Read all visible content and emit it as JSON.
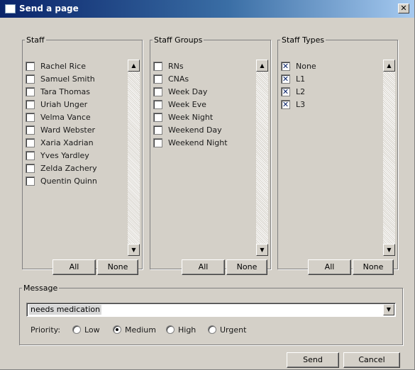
{
  "window": {
    "title": "Send a page",
    "close_glyph": "✕"
  },
  "staff": {
    "legend": "Staff",
    "items": [
      {
        "label": "Rachel Rice",
        "checked": false
      },
      {
        "label": "Samuel Smith",
        "checked": false
      },
      {
        "label": "Tara Thomas",
        "checked": false
      },
      {
        "label": "Uriah Unger",
        "checked": false
      },
      {
        "label": "Velma Vance",
        "checked": false
      },
      {
        "label": "Ward Webster",
        "checked": false
      },
      {
        "label": "Xaria Xadrian",
        "checked": false
      },
      {
        "label": "Yves Yardley",
        "checked": false
      },
      {
        "label": "Zelda Zachery",
        "checked": false
      },
      {
        "label": "Quentin Quinn",
        "checked": false
      }
    ],
    "all_label": "All",
    "none_label": "None"
  },
  "staff_groups": {
    "legend": "Staff Groups",
    "items": [
      {
        "label": "RNs",
        "checked": false
      },
      {
        "label": "CNAs",
        "checked": false
      },
      {
        "label": "Week Day",
        "checked": false
      },
      {
        "label": "Week Eve",
        "checked": false
      },
      {
        "label": "Week Night",
        "checked": false
      },
      {
        "label": "Weekend Day",
        "checked": false
      },
      {
        "label": "Weekend Night",
        "checked": false
      }
    ],
    "all_label": "All",
    "none_label": "None"
  },
  "staff_types": {
    "legend": "Staff Types",
    "items": [
      {
        "label": "None",
        "checked": true
      },
      {
        "label": "L1",
        "checked": true
      },
      {
        "label": "L2",
        "checked": true
      },
      {
        "label": "L3",
        "checked": true
      }
    ],
    "all_label": "All",
    "none_label": "None"
  },
  "message": {
    "legend": "Message",
    "value": "needs medication",
    "priority_label": "Priority:",
    "priorities": [
      {
        "label": "Low",
        "selected": false
      },
      {
        "label": "Medium",
        "selected": true
      },
      {
        "label": "High",
        "selected": false
      },
      {
        "label": "Urgent",
        "selected": false
      }
    ]
  },
  "buttons": {
    "send": "Send",
    "cancel": "Cancel"
  },
  "glyphs": {
    "check": "✕",
    "scroll_up": "▲",
    "scroll_down": "▼"
  },
  "colors": {
    "dialog_bg": "#d4d0c8",
    "title_start": "#0a246a",
    "title_end": "#a6caf0",
    "check_mark": "#0a246a"
  }
}
